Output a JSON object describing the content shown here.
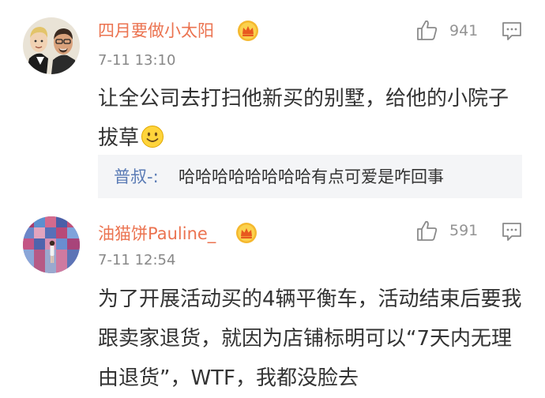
{
  "comments": [
    {
      "username": "四月要做小太阳",
      "timestamp": "7-11 13:10",
      "like_count": "941",
      "content": "让全公司去打扫他新买的别墅，给他的小院子拔草",
      "emoji": "smile-emoji",
      "reply": {
        "author": "普叔-:",
        "text": "哈哈哈哈哈哈哈哈有点可爱是咋回事"
      }
    },
    {
      "username": "油猫饼Pauline_",
      "timestamp": "7-11 12:54",
      "like_count": "591",
      "content": "为了开展活动买的4辆平衡车，活动结束后要我跟卖家退货，就因为店铺标明可以“7天内无理由退货”，WTF，我都没脸去"
    }
  ],
  "colors": {
    "username": "#eb7350",
    "reply_author": "#5a7bb5",
    "reply_bg": "#f4f5f7",
    "meta": "#888888",
    "vip_gold": "#f5b82e"
  },
  "icons": {
    "like": "thumbs-up-icon",
    "reply": "comment-bubble-icon",
    "vip": "vip-crown-badge"
  }
}
